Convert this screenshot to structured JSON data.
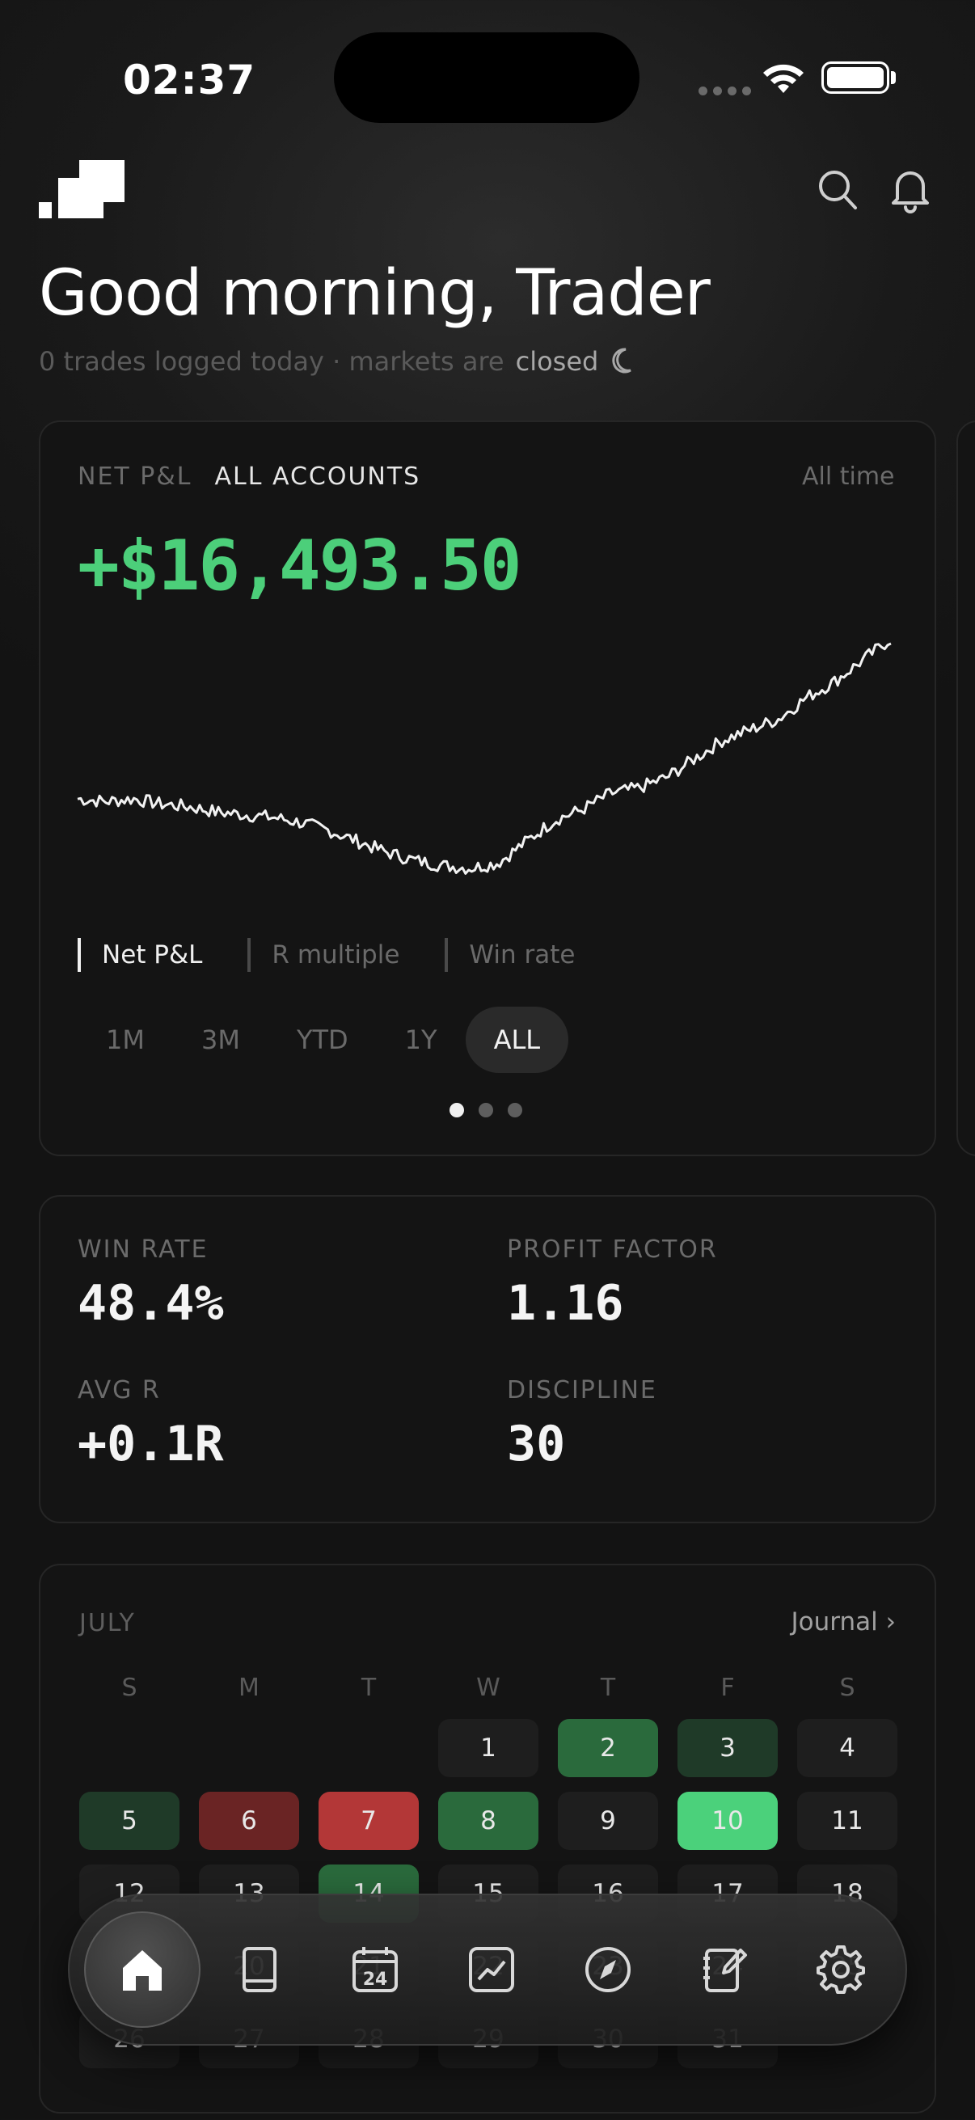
{
  "status_bar": {
    "time": "02:37"
  },
  "header": {
    "greeting": "Good morning, Trader",
    "subline_prefix": "0 trades logged today · markets are",
    "market_state": "closed"
  },
  "pnl_card": {
    "label": "NET P&L",
    "account": "ALL ACCOUNTS",
    "range_label": "All time",
    "value": "+$16,493.50",
    "value_color": "#4ccf7a",
    "metric_tabs": [
      {
        "label": "Net P&L",
        "active": true
      },
      {
        "label": "R multiple",
        "active": false
      },
      {
        "label": "Win rate",
        "active": false
      }
    ],
    "range_tabs": [
      {
        "label": "1M",
        "active": false
      },
      {
        "label": "3M",
        "active": false
      },
      {
        "label": "YTD",
        "active": false
      },
      {
        "label": "1Y",
        "active": false
      },
      {
        "label": "ALL",
        "active": true
      }
    ],
    "page_dots": 3,
    "active_dot": 0,
    "trend": [
      0.4,
      0.39,
      0.4,
      0.38,
      0.37,
      0.35,
      0.34,
      0.33,
      0.31,
      0.28,
      0.24,
      0.2,
      0.17,
      0.15,
      0.14,
      0.16,
      0.24,
      0.32,
      0.36,
      0.42,
      0.44,
      0.48,
      0.55,
      0.62,
      0.66,
      0.7,
      0.78,
      0.84,
      0.92,
      1.0
    ]
  },
  "stats": {
    "win_rate_label": "WIN RATE",
    "win_rate": "48.4%",
    "profit_factor_label": "PROFIT FACTOR",
    "profit_factor": "1.16",
    "avg_r_label": "AVG R",
    "avg_r": "+0.1R",
    "discipline_label": "DISCIPLINE",
    "discipline": "30"
  },
  "calendar": {
    "month": "JULY",
    "link": "Journal ›",
    "weekdays": [
      "S",
      "M",
      "T",
      "W",
      "T",
      "F",
      "S"
    ],
    "days": [
      {
        "d": "",
        "s": "empty"
      },
      {
        "d": "",
        "s": "empty"
      },
      {
        "d": "",
        "s": "empty"
      },
      {
        "d": "1",
        "s": ""
      },
      {
        "d": "2",
        "s": "g2"
      },
      {
        "d": "3",
        "s": "g1"
      },
      {
        "d": "4",
        "s": ""
      },
      {
        "d": "5",
        "s": "g1"
      },
      {
        "d": "6",
        "s": "r1"
      },
      {
        "d": "7",
        "s": "r2"
      },
      {
        "d": "8",
        "s": "g2"
      },
      {
        "d": "9",
        "s": ""
      },
      {
        "d": "10",
        "s": "g3"
      },
      {
        "d": "11",
        "s": ""
      },
      {
        "d": "12",
        "s": ""
      },
      {
        "d": "13",
        "s": ""
      },
      {
        "d": "14",
        "s": "g2"
      },
      {
        "d": "15",
        "s": ""
      },
      {
        "d": "16",
        "s": ""
      },
      {
        "d": "17",
        "s": ""
      },
      {
        "d": "18",
        "s": ""
      },
      {
        "d": "19",
        "s": ""
      },
      {
        "d": "20",
        "s": ""
      },
      {
        "d": "21",
        "s": ""
      },
      {
        "d": "22",
        "s": ""
      },
      {
        "d": "23",
        "s": ""
      },
      {
        "d": "24",
        "s": ""
      },
      {
        "d": "25",
        "s": ""
      },
      {
        "d": "26",
        "s": ""
      },
      {
        "d": "27",
        "s": ""
      },
      {
        "d": "28",
        "s": ""
      },
      {
        "d": "29",
        "s": ""
      },
      {
        "d": "30",
        "s": ""
      },
      {
        "d": "31",
        "s": ""
      }
    ]
  },
  "nav": {
    "items": [
      "home-icon",
      "book-icon",
      "calendar-icon",
      "chart-icon",
      "compass-icon",
      "journal-edit-icon",
      "gear-icon"
    ],
    "calendar_day": "24",
    "active": 0
  }
}
